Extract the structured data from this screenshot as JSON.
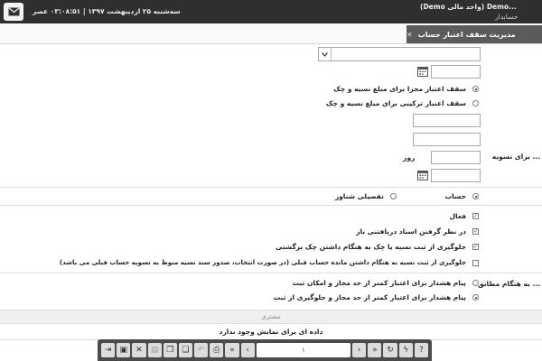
{
  "header": {
    "datetime": "سه‌شنبه ۲۵ اردیبهشت ۱۳۹۷ | ۰۳:۰۸:۵۱ عصر",
    "user": "...Demo (واحد مالی Demo)",
    "role": "حسابدار"
  },
  "page": {
    "tab_title": "مدیریت سقف اعتبار حساب",
    "tab_close": "✕"
  },
  "form": {
    "radio_separate": "سقف اعتبار مجزا برای مبلغ نسیه و چک",
    "radio_combined": "سقف اعتبار ترکیبی برای مبلغ نسیه و چک",
    "label_settlement": "... برای تسویه",
    "day_suffix": "روز",
    "radio_account": "حساب",
    "radio_detailed": "تفصیلی شناور",
    "chk_active": "فعال",
    "chk_received_docs": "در نظر گرفتن اسناد دریافتنی باز",
    "chk_block_returned": "جلوگیری از ثبت نسیه یا چک به هنگام داشتن چک برگشتی",
    "chk_block_balance": "جلوگیری از ثبت نسیه به هنگام داشتن مانده حساب قبلی (در صورت انتخاب، صدور سند نسیه منوط به تسویه حساب قبلی می باشد)",
    "label_match": "... به هنگام مطابق",
    "warn_allow": "پیام هشدار برای اعتبار کمتر از حد مجاز و امکان ثبت",
    "warn_block": "پیام هشدار برای اعتبار کمتر از حد مجاز و جلوگیری از ثبت"
  },
  "grid": {
    "column_customer": "مشتری",
    "empty_message": "داده ای برای نمایش وجود ندارد"
  },
  "toolbar": {
    "page_number": "۱"
  }
}
